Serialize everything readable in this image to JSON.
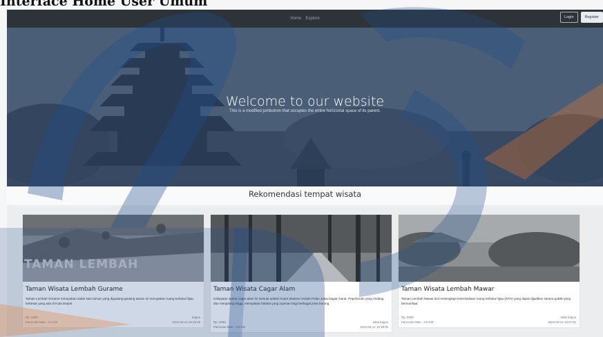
{
  "doc_heading": "Interface Home User Umum",
  "nav": {
    "links": [
      "Home",
      "Explore"
    ],
    "login": "Login",
    "register": "Register"
  },
  "jumbotron": {
    "title": "Welcome to our website",
    "subtitle": "This is a modified jumbotron that occupies the entire horizontal space of its parent."
  },
  "section_title": "Rekomendasi tempat wisata",
  "cards": [
    {
      "image_caption": "TAMAN LEMBAH",
      "title": "Taman Wisata Lembah Gurame",
      "description": "Taman Lembah Gurame merupakan salah satu taman yang digadang-gadang taman ini merupakan ruang terbuka hijau terbesar yang ada di Kota Depok.",
      "price": "Rp. 5000",
      "status": "bagus",
      "location": "Pancoran Mas - 2.1 KM",
      "date": "2023-03-12 16:26:49"
    },
    {
      "image_caption": "",
      "title": "Taman Wisata Cagar Alam",
      "description": "Kekayaan utama cagar alam ini semula adalah hutan dataran rendah Pulau Jawa bagian barat. Pepohonan yang rindang dan menjulang tinggi, merupakan habitat yang nyaman bagi berbagai jenis burung.",
      "price": "Rp. 5000",
      "status": "tidak bagus",
      "location": "Pancoran Mas - 3.5 KM",
      "date": "2023-03-12 16:38:35"
    },
    {
      "image_caption": "",
      "title": "Taman Wisata Lembah Mawar",
      "description": "Taman Lembah Mawar ikut melengkapi ketersediaan ruang terbuka hijau (RTH) yang dapat dijadikan sarana publik yang bermanfaat.",
      "price": "Rp. 5000",
      "status": "tidak bagus",
      "location": "Pancoran Mas - 3.3 KM",
      "date": "2023-03-12 16:47:53"
    }
  ],
  "colors": {
    "navbar": "#2d3339",
    "watermark_blue": "#1f4e8c",
    "watermark_orange": "#e8762b"
  }
}
